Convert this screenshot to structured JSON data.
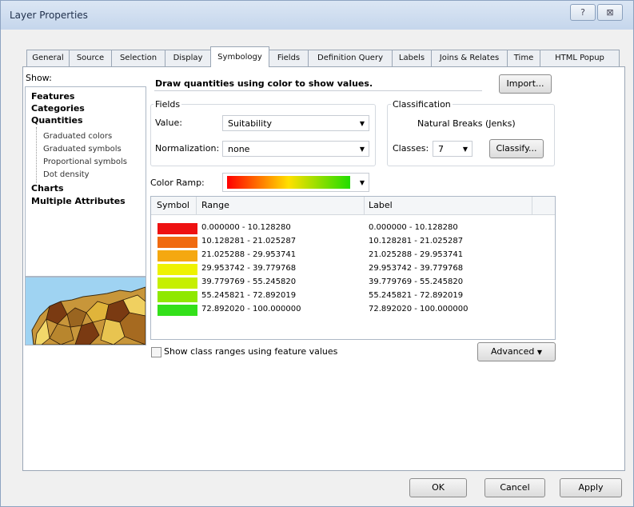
{
  "window": {
    "title": "Layer Properties",
    "help_glyph": "?",
    "close_glyph": "⊠"
  },
  "tabs": [
    "General",
    "Source",
    "Selection",
    "Display",
    "Symbology",
    "Fields",
    "Definition Query",
    "Labels",
    "Joins & Relates",
    "Time",
    "HTML Popup"
  ],
  "active_tab": "Symbology",
  "show": {
    "label": "Show:",
    "items": {
      "features": "Features",
      "categories": "Categories",
      "quantities": "Quantities",
      "graduated_colors": "Graduated colors",
      "graduated_symbols": "Graduated symbols",
      "proportional_symbols": "Proportional symbols",
      "dot_density": "Dot density",
      "charts": "Charts",
      "multiple_attributes": "Multiple Attributes"
    }
  },
  "header": {
    "text": "Draw quantities using color to show values.",
    "import_label": "Import..."
  },
  "fields": {
    "group_label": "Fields",
    "value_label": "Value:",
    "value": "Suitability",
    "normalization_label": "Normalization:",
    "normalization": "none"
  },
  "classification": {
    "group_label": "Classification",
    "method": "Natural Breaks (Jenks)",
    "classes_label": "Classes:",
    "classes": "7",
    "classify_label": "Classify..."
  },
  "color_ramp": {
    "label": "Color Ramp:",
    "start_color": "#ff0000",
    "mid_color": "#ffe000",
    "end_color": "#22dd00"
  },
  "table": {
    "headers": {
      "symbol": "Symbol",
      "range": "Range",
      "label": "Label"
    },
    "rows": [
      {
        "color": "#ee1111",
        "range": "0.000000 - 10.128280",
        "label": "0.000000 - 10.128280"
      },
      {
        "color": "#f06a10",
        "range": "10.128281 - 21.025287",
        "label": "10.128281 - 21.025287"
      },
      {
        "color": "#f5a810",
        "range": "21.025288 - 29.953741",
        "label": "21.025288 - 29.953741"
      },
      {
        "color": "#eef200",
        "range": "29.953742 - 39.779768",
        "label": "29.953742 - 39.779768"
      },
      {
        "color": "#c6ef00",
        "range": "39.779769 - 55.245820",
        "label": "39.779769 - 55.245820"
      },
      {
        "color": "#8fe800",
        "range": "55.245821 - 72.892019",
        "label": "55.245821 - 72.892019"
      },
      {
        "color": "#33e01a",
        "range": "72.892020 - 100.000000",
        "label": "72.892020 - 100.000000"
      }
    ]
  },
  "options": {
    "show_class_ranges_label": "Show class ranges using feature values",
    "show_class_ranges_checked": false,
    "advanced_label": "Advanced"
  },
  "footer": {
    "ok": "OK",
    "cancel": "Cancel",
    "apply": "Apply"
  }
}
